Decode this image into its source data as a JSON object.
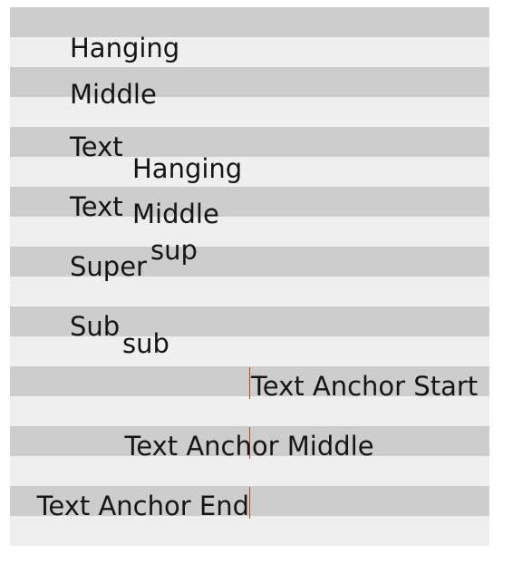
{
  "lines": {
    "hanging": "Hanging",
    "middle": "Middle",
    "text_hanging": {
      "text": "Text",
      "suffix": "Hanging"
    },
    "text_middle": {
      "text": "Text",
      "suffix": "Middle"
    },
    "super": {
      "base": "Super",
      "sup": "sup"
    },
    "sub": {
      "base": "Sub",
      "sub": "sub"
    },
    "anchor_start": "Text Anchor Start",
    "anchor_middle": "Text Anchor Middle",
    "anchor_end": "Text Anchor End"
  },
  "colors": {
    "stripe_dark": "#cdcdcd",
    "stripe_light": "#efefef",
    "text": "#151515",
    "anchor_line": "#b24a1e"
  }
}
